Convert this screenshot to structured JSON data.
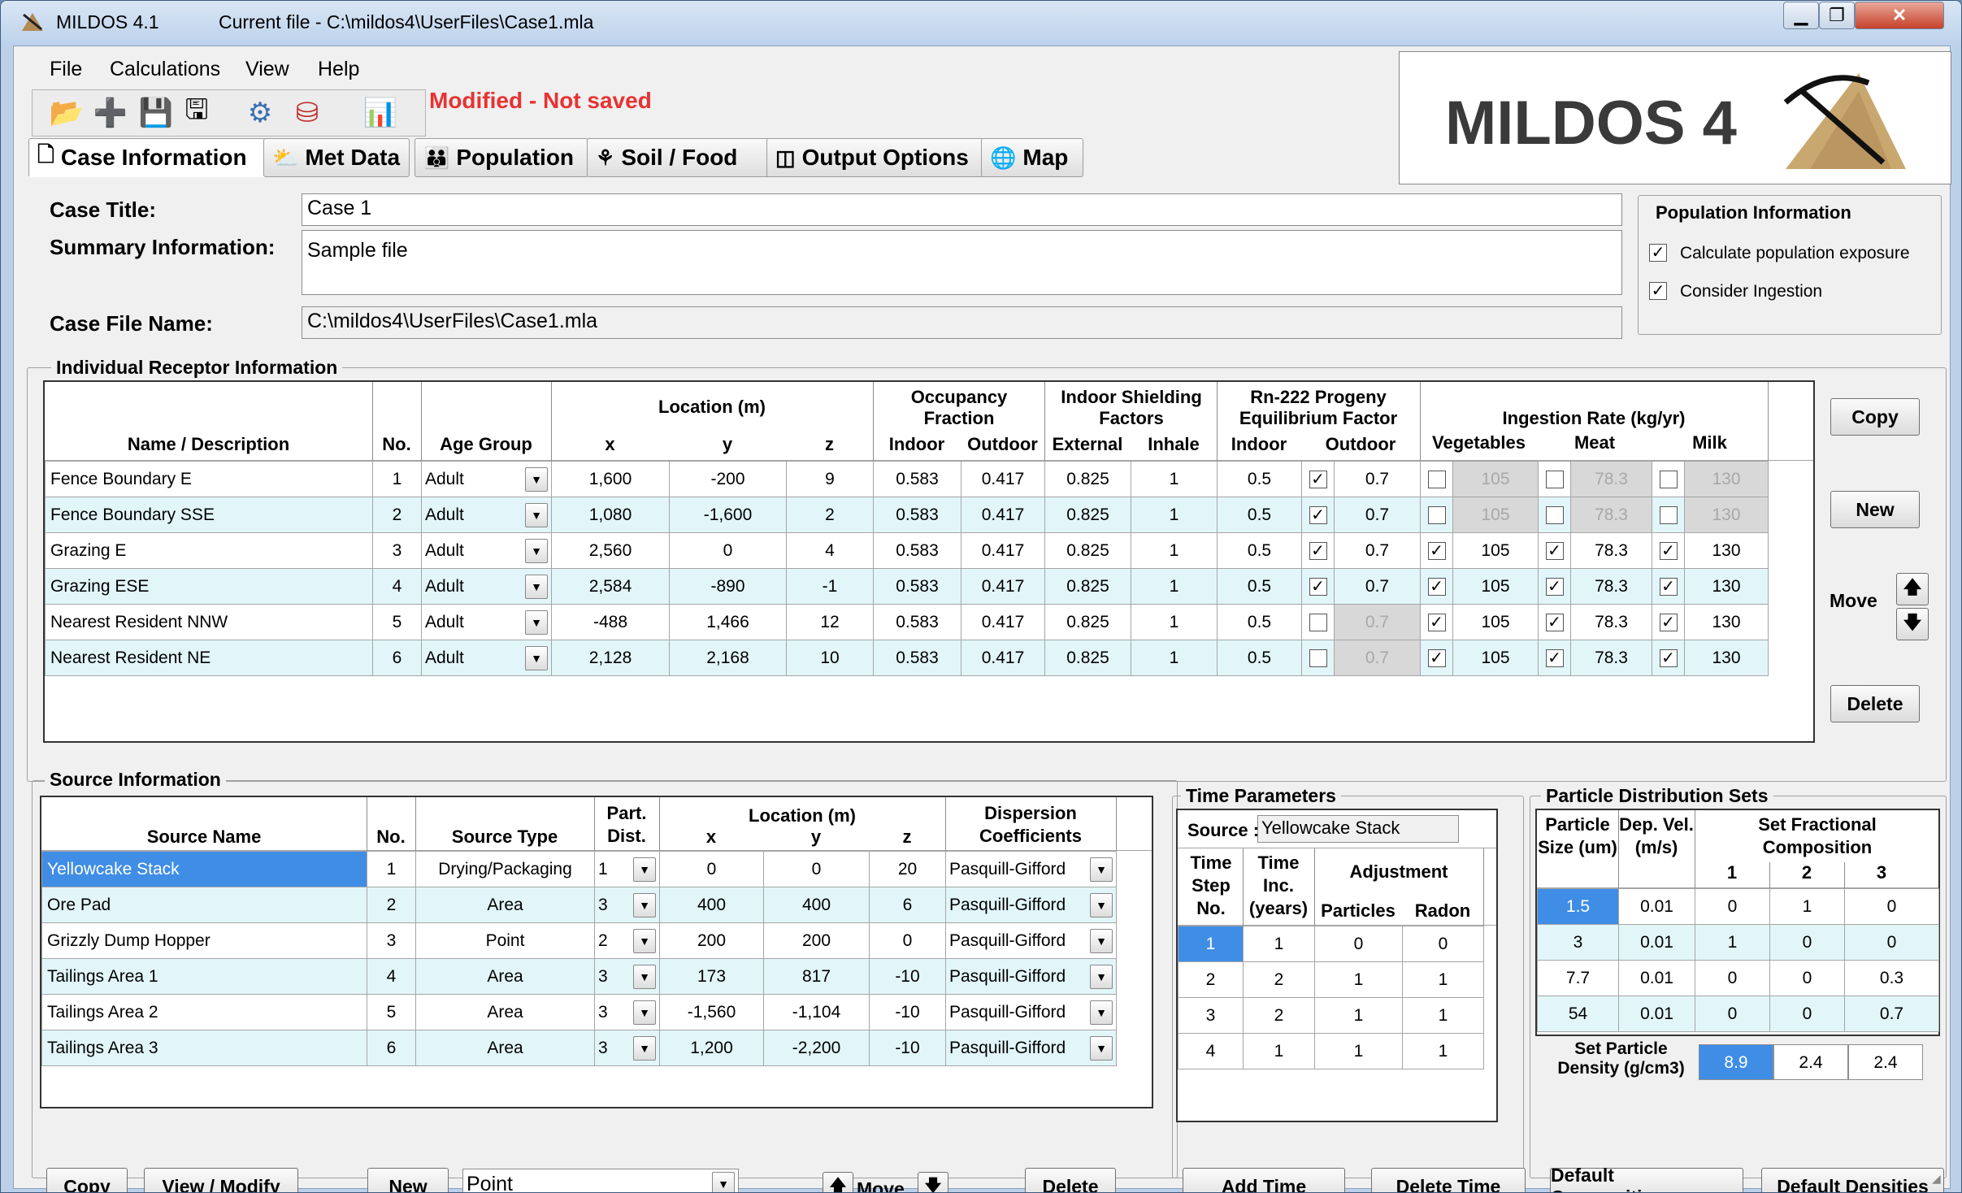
{
  "window": {
    "app_title": "MILDOS 4.1",
    "current_file": "Current file - C:\\mildos4\\UserFiles\\Case1.mla",
    "min": "▁",
    "max": "❐",
    "close": "✕"
  },
  "menu": [
    "File",
    "Calculations",
    "View",
    "Help"
  ],
  "toolbar": {
    "status": "Modified - Not saved",
    "icons": [
      "open-folder-icon",
      "new-file-icon",
      "save-icon",
      "save-all-icon",
      "settings-icon",
      "database-icon",
      "chart-icon"
    ]
  },
  "tabs": [
    "Case Information",
    "Met Data",
    "Population",
    "Soil / Food",
    "Output Options",
    "Map"
  ],
  "logo": {
    "text": "MILDOS 4"
  },
  "case": {
    "title_label": "Case Title:",
    "title": "Case 1",
    "summary_label": "Summary Information:",
    "summary": "Sample file",
    "file_label": "Case File Name:",
    "file": "C:\\mildos4\\UserFiles\\Case1.mla"
  },
  "population": {
    "title": "Population Information",
    "opt1": "Calculate population exposure",
    "opt2": "Consider Ingestion"
  },
  "receptors": {
    "title": "Individual Receptor Information",
    "headers": {
      "name": "Name / Description",
      "no": "No.",
      "age": "Age Group",
      "loc": "Location (m)",
      "x": "x",
      "y": "y",
      "z": "z",
      "occ": "Occupancy Fraction",
      "indoor": "Indoor",
      "outdoor": "Outdoor",
      "shield": "Indoor Shielding Factors",
      "external": "External",
      "inhale": "Inhale",
      "rn": "Rn-222 Progeny Equilibrium Factor",
      "rn_in": "Indoor",
      "rn_out": "Outdoor",
      "ing": "Ingestion Rate (kg/yr)",
      "veg": "Vegetables",
      "meat": "Meat",
      "milk": "Milk"
    },
    "rows": [
      {
        "name": "Fence Boundary E",
        "no": "1",
        "age": "Adult",
        "x": "1,600",
        "y": "-200",
        "z": "9",
        "oi": "0.583",
        "oo": "0.417",
        "ext": "0.825",
        "inh": "1",
        "rin": "0.5",
        "rout_c": true,
        "rout": "0.7",
        "veg_c": false,
        "veg": "105",
        "meat_c": false,
        "meat": "78.3",
        "milk_c": false,
        "milk": "130"
      },
      {
        "name": "Fence Boundary SSE",
        "no": "2",
        "age": "Adult",
        "x": "1,080",
        "y": "-1,600",
        "z": "2",
        "oi": "0.583",
        "oo": "0.417",
        "ext": "0.825",
        "inh": "1",
        "rin": "0.5",
        "rout_c": true,
        "rout": "0.7",
        "veg_c": false,
        "veg": "105",
        "meat_c": false,
        "meat": "78.3",
        "milk_c": false,
        "milk": "130"
      },
      {
        "name": "Grazing E",
        "no": "3",
        "age": "Adult",
        "x": "2,560",
        "y": "0",
        "z": "4",
        "oi": "0.583",
        "oo": "0.417",
        "ext": "0.825",
        "inh": "1",
        "rin": "0.5",
        "rout_c": true,
        "rout": "0.7",
        "veg_c": true,
        "veg": "105",
        "meat_c": true,
        "meat": "78.3",
        "milk_c": true,
        "milk": "130"
      },
      {
        "name": "Grazing ESE",
        "no": "4",
        "age": "Adult",
        "x": "2,584",
        "y": "-890",
        "z": "-1",
        "oi": "0.583",
        "oo": "0.417",
        "ext": "0.825",
        "inh": "1",
        "rin": "0.5",
        "rout_c": true,
        "rout": "0.7",
        "veg_c": true,
        "veg": "105",
        "meat_c": true,
        "meat": "78.3",
        "milk_c": true,
        "milk": "130"
      },
      {
        "name": "Nearest Resident NNW",
        "no": "5",
        "age": "Adult",
        "x": "-488",
        "y": "1,466",
        "z": "12",
        "oi": "0.583",
        "oo": "0.417",
        "ext": "0.825",
        "inh": "1",
        "rin": "0.5",
        "rout_c": false,
        "rout": "0.7",
        "veg_c": true,
        "veg": "105",
        "meat_c": true,
        "meat": "78.3",
        "milk_c": true,
        "milk": "130"
      },
      {
        "name": "Nearest Resident NE",
        "no": "6",
        "age": "Adult",
        "x": "2,128",
        "y": "2,168",
        "z": "10",
        "oi": "0.583",
        "oo": "0.417",
        "ext": "0.825",
        "inh": "1",
        "rin": "0.5",
        "rout_c": false,
        "rout": "0.7",
        "veg_c": true,
        "veg": "105",
        "meat_c": true,
        "meat": "78.3",
        "milk_c": true,
        "milk": "130"
      }
    ],
    "buttons": {
      "copy": "Copy",
      "new": "New",
      "move": "Move",
      "delete": "Delete"
    }
  },
  "sources": {
    "title": "Source Information",
    "headers": {
      "name": "Source Name",
      "no": "No.",
      "type": "Source Type",
      "part": "Part. Dist.",
      "loc": "Location (m)",
      "x": "x",
      "y": "y",
      "z": "z",
      "disp": "Dispersion Coefficients"
    },
    "rows": [
      {
        "name": "Yellowcake Stack",
        "no": "1",
        "type": "Drying/Packaging",
        "part": "1",
        "x": "0",
        "y": "0",
        "z": "20",
        "disp": "Pasquill-Gifford"
      },
      {
        "name": "Ore Pad",
        "no": "2",
        "type": "Area",
        "part": "3",
        "x": "400",
        "y": "400",
        "z": "6",
        "disp": "Pasquill-Gifford"
      },
      {
        "name": "Grizzly Dump Hopper",
        "no": "3",
        "type": "Point",
        "part": "2",
        "x": "200",
        "y": "200",
        "z": "0",
        "disp": "Pasquill-Gifford"
      },
      {
        "name": "Tailings Area 1",
        "no": "4",
        "type": "Area",
        "part": "3",
        "x": "173",
        "y": "817",
        "z": "-10",
        "disp": "Pasquill-Gifford"
      },
      {
        "name": "Tailings Area 2",
        "no": "5",
        "type": "Area",
        "part": "3",
        "x": "-1,560",
        "y": "-1,104",
        "z": "-10",
        "disp": "Pasquill-Gifford"
      },
      {
        "name": "Tailings Area 3",
        "no": "6",
        "type": "Area",
        "part": "3",
        "x": "1,200",
        "y": "-2,200",
        "z": "-10",
        "disp": "Pasquill-Gifford"
      }
    ],
    "buttons": {
      "copy": "Copy",
      "view": "View / Modify",
      "new": "New",
      "type_select": "Point",
      "move": "Move",
      "delete": "Delete"
    }
  },
  "time": {
    "title": "Time Parameters",
    "source_label": "Source :",
    "source": "Yellowcake Stack",
    "headers": {
      "step": "Time Step No.",
      "inc": "Time Inc. (years)",
      "adj": "Adjustment",
      "particles": "Particles",
      "radon": "Radon"
    },
    "rows": [
      [
        "1",
        "1",
        "0",
        "0"
      ],
      [
        "2",
        "2",
        "1",
        "1"
      ],
      [
        "3",
        "2",
        "1",
        "1"
      ],
      [
        "4",
        "1",
        "1",
        "1"
      ]
    ],
    "buttons": {
      "add": "Add Time",
      "delete": "Delete Time"
    }
  },
  "particles": {
    "title": "Particle Distribution Sets",
    "headers": {
      "size": "Particle Size (um)",
      "dep": "Dep. Vel. (m/s)",
      "set": "Set Fractional Composition",
      "c1": "1",
      "c2": "2",
      "c3": "3"
    },
    "rows": [
      [
        "1.5",
        "0.01",
        "0",
        "1",
        "0"
      ],
      [
        "3",
        "0.01",
        "1",
        "0",
        "0"
      ],
      [
        "7.7",
        "0.01",
        "0",
        "0",
        "0.3"
      ],
      [
        "54",
        "0.01",
        "0",
        "0",
        "0.7"
      ]
    ],
    "density_label": "Set Particle Density (g/cm3)",
    "density": [
      "8.9",
      "2.4",
      "2.4"
    ],
    "buttons": {
      "comp": "Default Compositions",
      "dens": "Default Densities"
    }
  }
}
